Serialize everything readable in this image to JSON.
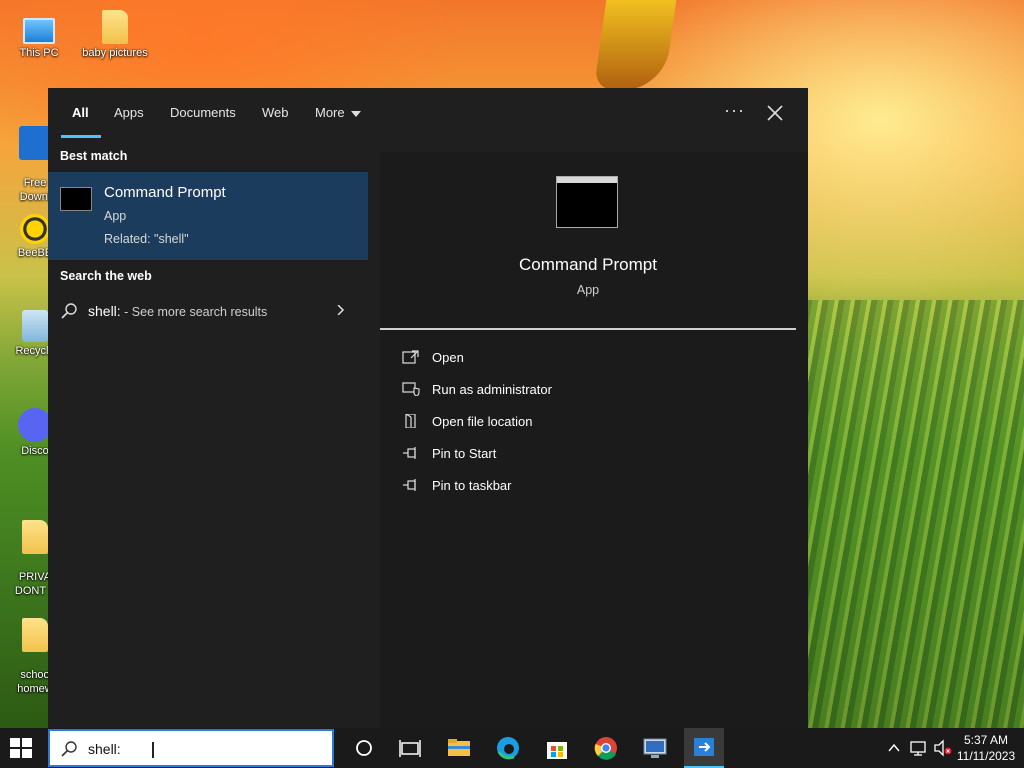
{
  "desktop_icons": [
    {
      "label": "This PC",
      "icon": "pc-icon"
    },
    {
      "label": "baby pictures",
      "icon": "folder-icon"
    },
    {
      "label": "Free\nDownl",
      "icon": "app-icon"
    },
    {
      "label": "BeeBE",
      "icon": "bee-icon"
    },
    {
      "label": "Recycle",
      "icon": "recycle-bin-icon"
    },
    {
      "label": "Disco",
      "icon": "discord-icon"
    },
    {
      "label": "PRIVA\nDONT L",
      "icon": "folder-icon"
    },
    {
      "label": "schoo\nhomew",
      "icon": "folder-icon"
    }
  ],
  "tabs": [
    {
      "label": "All",
      "active": true
    },
    {
      "label": "Apps"
    },
    {
      "label": "Documents"
    },
    {
      "label": "Web"
    },
    {
      "label": "More"
    }
  ],
  "header": {
    "ellipsis": "···"
  },
  "left": {
    "best_match_title": "Best match",
    "best_match": {
      "title": "Command Prompt",
      "type": "App",
      "related": "Related: \"shell\""
    },
    "web_title": "Search the web",
    "web_query": "shell:",
    "web_more": " - See more search results"
  },
  "preview": {
    "title": "Command Prompt",
    "type": "App"
  },
  "actions": [
    {
      "label": "Open",
      "icon": "open-icon"
    },
    {
      "label": "Run as administrator",
      "icon": "shield-icon"
    },
    {
      "label": "Open file location",
      "icon": "file-location-icon"
    },
    {
      "label": "Pin to Start",
      "icon": "pin-icon"
    },
    {
      "label": "Pin to taskbar",
      "icon": "pin-icon"
    }
  ],
  "taskbar": {
    "search_value": "shell:",
    "time": "5:37 AM",
    "date": "11/11/2023"
  },
  "colors": {
    "accent": "#4cc2ff",
    "selected": "#1c3c5e",
    "panel": "#1f1f1f"
  }
}
